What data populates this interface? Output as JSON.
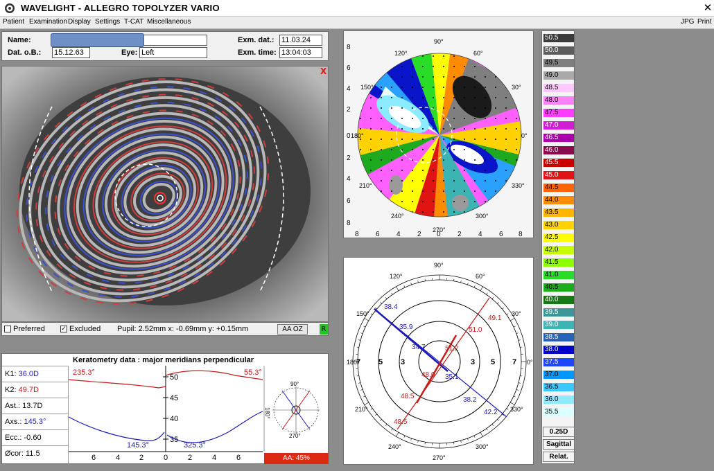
{
  "app": {
    "title": "WAVELIGHT  -  ALLEGRO TOPOLYZER VARIO",
    "close_label": "✕"
  },
  "menu": {
    "left": [
      "Patient",
      "Examination",
      "Display",
      "Settings",
      "T-CAT",
      "Miscellaneous"
    ],
    "right": [
      "JPG",
      "Print"
    ]
  },
  "patient": {
    "name_label": "Name:",
    "dob_label": "Dat. o.B.:",
    "dob": "15.12.63",
    "eye_label": "Eye:",
    "eye": "Left",
    "exam_date_label": "Exm. dat.:",
    "exam_date": "11.03.24",
    "exam_time_label": "Exm. time:",
    "exam_time": "13:04:03"
  },
  "eye_image": {
    "close_mark": "X",
    "preferred_label": "Preferred",
    "excluded_label": "Excluded",
    "excluded_mark": "✓",
    "pupil_text": "Pupil: 2.52mm x: -0.69mm y: +0.15mm",
    "aa_oz_label": "AA OZ",
    "r_badge": "R"
  },
  "keratometry": {
    "title": "Keratometry data : major meridians perpendicular",
    "k1_label": "K1:",
    "k1": "36.0D",
    "k2_label": "K2:",
    "k2": "49.7D",
    "ast_label": "Ast.:",
    "ast": "13.7D",
    "axs_label": "Axs.:",
    "axs": "145.3°",
    "ecc_label": "Ecc.:",
    "ecc": "-0.60",
    "ocor_label": "Øcor:",
    "ocor": "11.5",
    "aa_label": "AA: 45%",
    "red_left": "235.3°",
    "red_right": "55.3°",
    "blue_left": "145.3°",
    "blue_right": "325.3°",
    "y_ticks": [
      "50",
      "45",
      "40",
      "35"
    ],
    "x_ticks": [
      "6",
      "4",
      "2",
      "0",
      "2",
      "4",
      "6"
    ],
    "mini_top": "90°",
    "mini_left": "180°",
    "mini_bottom": "270°"
  },
  "topo_map": {
    "angles": [
      "90°",
      "120°",
      "60°",
      "150°",
      "30°",
      "180°",
      "0°",
      "210°",
      "330°",
      "240°",
      "300°",
      "270°"
    ],
    "y_ticks": [
      "8",
      "6",
      "4",
      "2",
      "0",
      "2",
      "4",
      "6",
      "8"
    ],
    "x_ticks": [
      "8",
      "6",
      "4",
      "2",
      "0",
      "2",
      "4",
      "6",
      "8"
    ]
  },
  "meridian_plot": {
    "angles": [
      "90°",
      "120°",
      "60°",
      "150°",
      "30°",
      "180°",
      "0°",
      "210°",
      "330°",
      "240°",
      "300°",
      "270°"
    ],
    "ring_labels": [
      "7",
      "5",
      "3",
      "3",
      "5",
      "7"
    ],
    "blue_values": [
      "38.4",
      "35.9",
      "34.7",
      "35.1",
      "38.2",
      "42.2"
    ],
    "red_values": [
      "49.1",
      "51.0",
      "51.2",
      "48.0",
      "48.5",
      "48.5"
    ]
  },
  "scale": {
    "values": [
      "50.5",
      "50.0",
      "49.5",
      "49.0",
      "48.5",
      "48.0",
      "47.5",
      "47.0",
      "46.5",
      "46.0",
      "45.5",
      "45.0",
      "44.5",
      "44.0",
      "43.5",
      "43.0",
      "42.5",
      "42.0",
      "41.5",
      "41.0",
      "40.5",
      "40.0",
      "39.5",
      "39.0",
      "38.5",
      "38.0",
      "37.5",
      "37.0",
      "36.5",
      "36.0",
      "35.5"
    ],
    "colors": [
      "#3a3a3a",
      "#5c5c5c",
      "#7f7f7f",
      "#a9a9a9",
      "#ffc8ff",
      "#ff80ff",
      "#ff3cff",
      "#d21ed2",
      "#aa00aa",
      "#8c0a4b",
      "#c80000",
      "#e11414",
      "#ff6400",
      "#ff8c00",
      "#ffb400",
      "#ffd200",
      "#ffff00",
      "#c8ff00",
      "#8cff00",
      "#28dc28",
      "#1eaa1e",
      "#147814",
      "#3c9696",
      "#3cb4b4",
      "#2864b4",
      "#0000c8",
      "#1e46ff",
      "#0096ff",
      "#3cc8ff",
      "#8cebff",
      "#dcffff"
    ],
    "text_light": [
      true,
      true,
      false,
      false,
      false,
      false,
      false,
      true,
      true,
      true,
      true,
      true,
      false,
      false,
      false,
      false,
      false,
      false,
      false,
      false,
      false,
      true,
      true,
      true,
      true,
      true,
      true,
      false,
      false,
      false,
      false
    ],
    "step_label": "0.25D",
    "mode_label": "Sagittal",
    "type_label": "Relat."
  },
  "colors": {
    "k1_blue": "#1a1ab4",
    "k2_red": "#c41a1a",
    "aa_red": "#dc2814",
    "redaction": "#6f8fc7"
  }
}
